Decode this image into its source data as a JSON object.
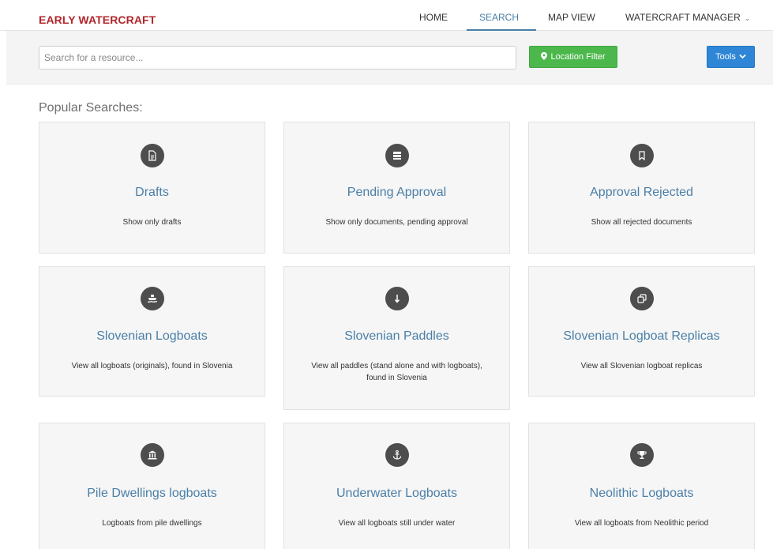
{
  "brand": "EARLY WATERCRAFT",
  "nav": {
    "home": "HOME",
    "search": "SEARCH",
    "map_view": "MAP VIEW",
    "manager": "WATERCRAFT MANAGER",
    "manager_caret": "⌄"
  },
  "search": {
    "placeholder": "Search for a resource...",
    "location_filter": "Location Filter",
    "tools": "Tools"
  },
  "popular": {
    "heading": "Popular Searches:",
    "cards": [
      {
        "title": "Drafts",
        "desc": "Show only drafts",
        "icon": "document-icon"
      },
      {
        "title": "Pending Approval",
        "desc": "Show only documents, pending approval",
        "icon": "server-icon"
      },
      {
        "title": "Approval Rejected",
        "desc": "Show all rejected documents",
        "icon": "bookmark-icon"
      },
      {
        "title": "Slovenian Logboats",
        "desc": "View all logboats (originals), found in Slovenia",
        "icon": "ship-icon"
      },
      {
        "title": "Slovenian Paddles",
        "desc": "View all paddles (stand alone and with logboats), found in Slovenia",
        "icon": "arrow-down-icon"
      },
      {
        "title": "Slovenian Logboat Replicas",
        "desc": "View all Slovenian logboat replicas",
        "icon": "copy-icon"
      },
      {
        "title": "Pile Dwellings logboats",
        "desc": "Logboats from pile dwellings",
        "icon": "museum-icon"
      },
      {
        "title": "Underwater Logboats",
        "desc": "View all logboats still under water",
        "icon": "anchor-icon"
      },
      {
        "title": "Neolithic Logboats",
        "desc": "View all logboats from Neolithic period",
        "icon": "trophy-icon"
      }
    ]
  },
  "colors": {
    "brand": "#b0262c",
    "link": "#4a7fa8",
    "location_button": "#4cb84c",
    "tools_button": "#2f86d6",
    "icon_circle": "#4d4d4d"
  }
}
